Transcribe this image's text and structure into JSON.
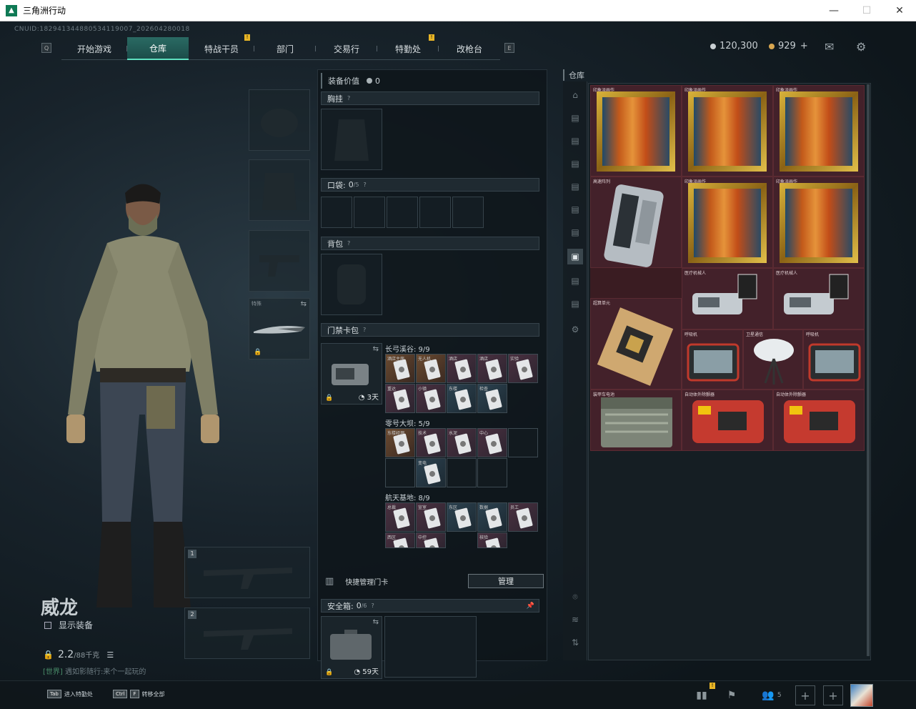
{
  "window": {
    "title": "三角洲行动",
    "minimize": "—",
    "maximize": "☐",
    "close": "✕"
  },
  "uid": "CNUID:1829413448805341190​07_202604280018",
  "nav": {
    "tabs": [
      {
        "label": "开始游戏",
        "active": false,
        "alert": false
      },
      {
        "label": "仓库",
        "active": true,
        "alert": false
      },
      {
        "label": "特战干员",
        "active": false,
        "alert": true
      },
      {
        "label": "部门",
        "active": false,
        "alert": false
      },
      {
        "label": "交易行",
        "active": false,
        "alert": false
      },
      {
        "label": "特勤处",
        "active": false,
        "alert": true
      },
      {
        "label": "改枪台",
        "active": false,
        "alert": false
      }
    ],
    "left_key": "Q",
    "right_key": "E",
    "alert_mark": "!"
  },
  "currency": {
    "silver": "120,300",
    "gold": "929",
    "gold_plus": "+"
  },
  "character": {
    "name": "威龙",
    "show_equipment_label": "显示装备",
    "weight_value": "2.2",
    "weight_max": "/88千克",
    "chat_channel": "[世界]",
    "chat_user": "遇如影随行",
    "chat_text": ":来个一起玩的"
  },
  "left_slots": {
    "melee_label": "特殊",
    "weapon1_num": "1",
    "weapon2_num": "2"
  },
  "middle": {
    "equip_value_label": "装备价值",
    "equip_value": "0",
    "chest_rig": "胸挂",
    "pockets": "口袋:",
    "pockets_count": "0",
    "pockets_max": "/5",
    "backpack": "背包",
    "keycard_case": "门禁卡包",
    "keycase_days": "3天",
    "maps": [
      {
        "label": "长弓溪谷: 9/9"
      },
      {
        "label": "零号大坝: 5/9"
      },
      {
        "label": "航天基地: 8/9"
      }
    ],
    "quick_manage": "快捷管理门卡",
    "manage_button": "管理",
    "safebox": "安全箱:",
    "safebox_count": "0",
    "safebox_max": "/6",
    "safebox_days": "59天",
    "question_mark": "?"
  },
  "keycards": {
    "valley_row1": [
      "酒店主房",
      "无人机",
      "酒店",
      "酒店",
      "实验"
    ],
    "valley_row2": [
      "重达",
      "小镇",
      "东楼",
      "检查"
    ],
    "dam_row1": [
      "东楼经理",
      "技术",
      "水泥",
      "中心"
    ],
    "dam_row2": [
      "变电"
    ],
    "base_row1": [
      "总裁",
      "宣室",
      "东区",
      "数据",
      "员工"
    ],
    "base_row2": [
      "西区",
      "中控",
      "核验"
    ]
  },
  "warehouse": {
    "label": "仓库",
    "items": {
      "painting": "印象派画作",
      "server": "高速阵列",
      "robot": "医疗机械人",
      "gpu": "超算单元",
      "radio": "呼吸机",
      "satellite": "卫星通信",
      "ammo_box": "装甲车电池",
      "case": "自动体外除颤器"
    }
  },
  "bottom": {
    "hint1_key": "Tab",
    "hint1_text": "进入特勤处",
    "hint2_key1": "Ctrl",
    "hint2_key2": "F",
    "hint2_text": "转移全部",
    "friends_count": "5",
    "plus": "+"
  },
  "colors": {
    "accent": "#5fe0c0",
    "warehouse_bg": "#3a1c22",
    "alert": "#e8b526"
  }
}
